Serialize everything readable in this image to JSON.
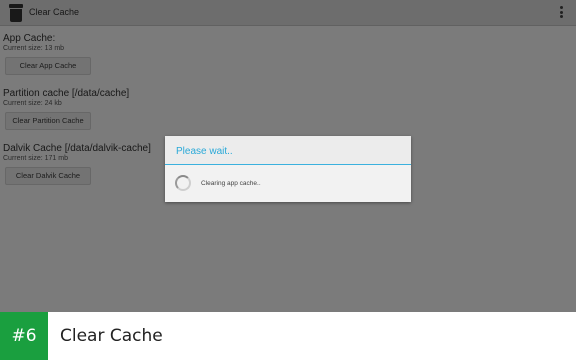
{
  "app": {
    "title": "Clear Cache",
    "icon": "trash-can-icon",
    "menu_icon": "overflow-menu-icon"
  },
  "sections": [
    {
      "title": "App Cache:",
      "size": "Current size: 13 mb",
      "button": "Clear App Cache"
    },
    {
      "title": "Partition cache [/data/cache]",
      "size": "Current size: 24 kb",
      "button": "Clear Partition Cache"
    },
    {
      "title": "Dalvik Cache [/data/dalvik-cache]",
      "size": "Current size: 171 mb",
      "button": "Clear Dalvik Cache"
    }
  ],
  "dialog": {
    "title": "Please wait..",
    "message": "Clearing app cache..",
    "accent_color": "#2aa9d8"
  },
  "banner": {
    "rank": "#6",
    "title": "Clear Cache",
    "rank_color": "#1a9f3f"
  }
}
